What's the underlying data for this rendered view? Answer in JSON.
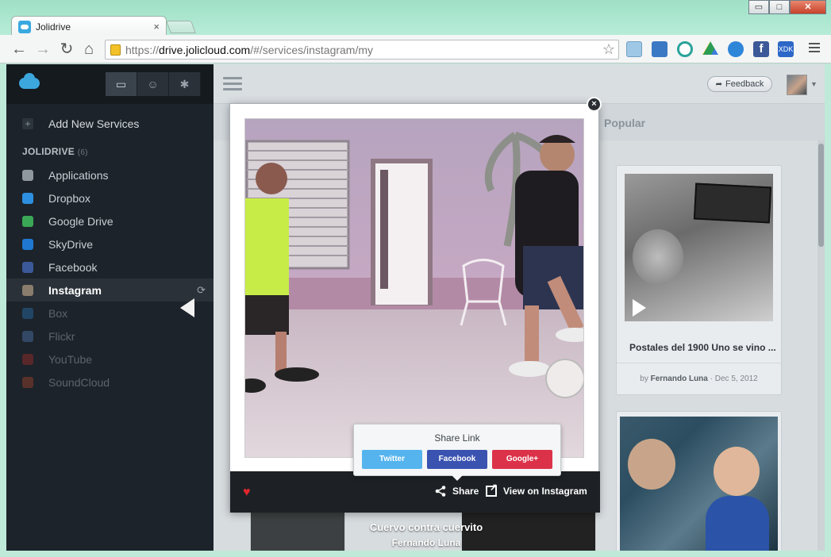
{
  "browser": {
    "tab_title": "Jolidrive",
    "tab_close": "×",
    "url_scheme": "https://",
    "url_host": "drive.jolicloud.com",
    "url_path": "/#/services/instagram/my",
    "window_controls": [
      "▭",
      "□",
      "✕"
    ]
  },
  "sidebar": {
    "add_service_label": "Add New Services",
    "section_label": "JOLIDRIVE",
    "section_count": "(6)",
    "items": [
      {
        "label": "Applications",
        "icon": "applications-icon",
        "color": "#8f989f",
        "state": "normal"
      },
      {
        "label": "Dropbox",
        "icon": "dropbox-icon",
        "color": "#2d8fe0",
        "state": "normal"
      },
      {
        "label": "Google Drive",
        "icon": "google-drive-icon",
        "color": "#3aa757",
        "state": "normal"
      },
      {
        "label": "SkyDrive",
        "icon": "skydrive-icon",
        "color": "#1f78d1",
        "state": "normal"
      },
      {
        "label": "Facebook",
        "icon": "facebook-icon",
        "color": "#3b5998",
        "state": "normal"
      },
      {
        "label": "Instagram",
        "icon": "instagram-icon",
        "color": "#8a7d6d",
        "state": "active"
      },
      {
        "label": "Box",
        "icon": "box-icon",
        "color": "#2a8ad4",
        "state": "disabled"
      },
      {
        "label": "Flickr",
        "icon": "flickr-icon",
        "color": "#5b8fd4",
        "state": "disabled"
      },
      {
        "label": "YouTube",
        "icon": "youtube-icon",
        "color": "#c9302c",
        "state": "disabled"
      },
      {
        "label": "SoundCloud",
        "icon": "soundcloud-icon",
        "color": "#c8512a",
        "state": "disabled"
      }
    ]
  },
  "header": {
    "feedback_label": "Feedback"
  },
  "filter": {
    "popular_label": "Popular"
  },
  "cards": [
    {
      "title": "Postales del 1900 Uno se vino ...",
      "by": "by",
      "author": "Fernando Luna",
      "separator": "·",
      "date": "Dec 5, 2012"
    }
  ],
  "behind": {
    "caption_title": "Cuervo contra cuervito",
    "caption_author": "Fernando Luna"
  },
  "lightbox": {
    "close_label": "×",
    "share_label": "Share",
    "view_label": "View on Instagram",
    "share_popup": {
      "title": "Share Link",
      "options": [
        {
          "label": "Twitter",
          "color": "#55b4ee"
        },
        {
          "label": "Facebook",
          "color": "#3a52b0"
        },
        {
          "label": "Google+",
          "color": "#dc3249"
        }
      ]
    }
  }
}
